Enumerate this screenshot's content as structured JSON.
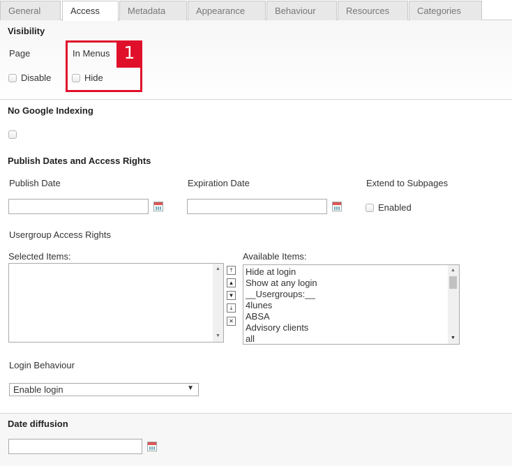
{
  "tabs": [
    {
      "label": "General"
    },
    {
      "label": "Access"
    },
    {
      "label": "Metadata"
    },
    {
      "label": "Appearance"
    },
    {
      "label": "Behaviour"
    },
    {
      "label": "Resources"
    },
    {
      "label": "Categories"
    }
  ],
  "visibility": {
    "heading": "Visibility",
    "page_label": "Page",
    "in_menus_label": "In Menus",
    "disable_label": "Disable",
    "hide_label": "Hide",
    "annotation_number": "1"
  },
  "google": {
    "heading": "No Google Indexing"
  },
  "publish": {
    "heading": "Publish Dates and Access Rights",
    "publish_date_label": "Publish Date",
    "expiration_date_label": "Expiration Date",
    "extend_label": "Extend to Subpages",
    "enabled_label": "Enabled",
    "publish_date_value": "",
    "expiration_date_value": ""
  },
  "usergroups": {
    "heading": "Usergroup Access Rights",
    "selected_label": "Selected Items:",
    "available_label": "Available Items:",
    "available_items": [
      "Hide at login",
      "Show at any login",
      "__Usergroups:__",
      "4lunes",
      "ABSA",
      "Advisory clients",
      "all"
    ]
  },
  "login": {
    "heading": "Login Behaviour",
    "selected": "Enable login"
  },
  "diffusion": {
    "heading": "Date diffusion",
    "value": ""
  },
  "colors": {
    "annotation": "#e0102a"
  }
}
